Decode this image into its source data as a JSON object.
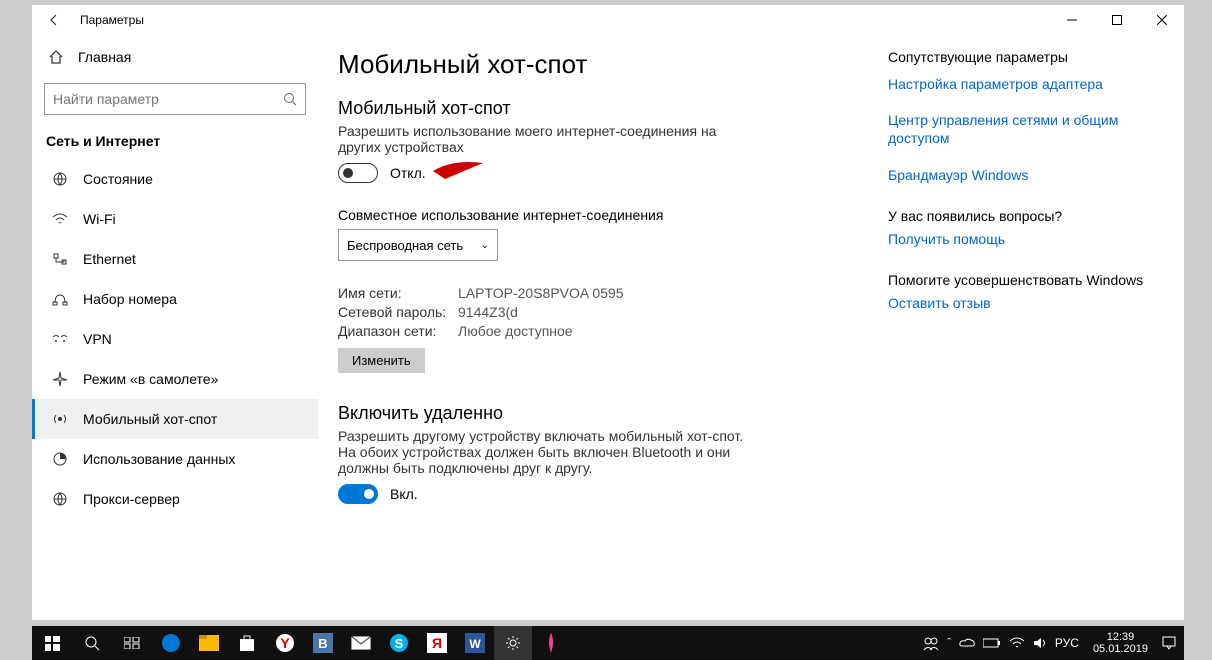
{
  "window_title": "Параметры",
  "home_label": "Главная",
  "search_placeholder": "Найти параметр",
  "category": "Сеть и Интернет",
  "nav": [
    {
      "icon": "status",
      "label": "Состояние"
    },
    {
      "icon": "wifi",
      "label": "Wi-Fi"
    },
    {
      "icon": "ethernet",
      "label": "Ethernet"
    },
    {
      "icon": "dialup",
      "label": "Набор номера"
    },
    {
      "icon": "vpn",
      "label": "VPN"
    },
    {
      "icon": "airplane",
      "label": "Режим «в самолете»"
    },
    {
      "icon": "hotspot",
      "label": "Мобильный хот-спот",
      "active": true
    },
    {
      "icon": "data",
      "label": "Использование данных"
    },
    {
      "icon": "proxy",
      "label": "Прокси-сервер"
    }
  ],
  "page_title": "Мобильный хот-спот",
  "hotspot_section": {
    "title": "Мобильный хот-спот",
    "desc": "Разрешить использование моего интернет-соединения на других устройствах",
    "toggle_state": "Откл."
  },
  "share_label": "Совместное использование интернет-соединения",
  "share_value": "Беспроводная сеть",
  "info": {
    "name_label": "Имя сети:",
    "name_value": "LAPTOP-20S8PVOA 0595",
    "pass_label": "Сетевой пароль:",
    "pass_value": "9144Z3(d",
    "band_label": "Диапазон сети:",
    "band_value": "Любое доступное"
  },
  "edit_btn": "Изменить",
  "remote_section": {
    "title": "Включить удаленно",
    "desc": "Разрешить другому устройству включать мобильный хот-спот. На обоих устройствах должен быть включен Bluetooth и они должны быть подключены друг к другу.",
    "toggle_state": "Вкл."
  },
  "related": {
    "heading": "Сопутствующие параметры",
    "links": [
      "Настройка параметров адаптера",
      "Центр управления сетями и общим доступом",
      "Брандмауэр Windows"
    ],
    "question": "У вас появились вопросы?",
    "help_link": "Получить помощь",
    "feedback_head": "Помогите усовершенствовать Windows",
    "feedback_link": "Оставить отзыв"
  },
  "taskbar": {
    "lang": "РУС",
    "time": "12:39",
    "date": "05.01.2019"
  }
}
